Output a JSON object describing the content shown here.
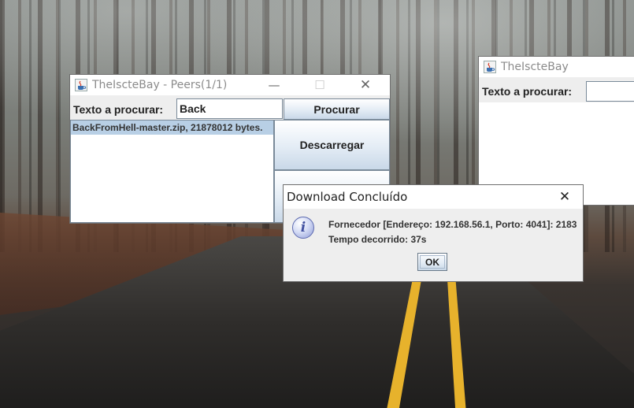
{
  "main_window": {
    "title": "TheIscteBay - Peers(1/1)",
    "search_label": "Texto a procurar:",
    "search_value": "Back",
    "search_button": "Procurar",
    "results": [
      "BackFromHell-master.zip, 21878012 bytes."
    ],
    "download_button": "Descarregar",
    "controls": {
      "minimize": "—",
      "maximize": "☐",
      "close": "✕"
    }
  },
  "second_window": {
    "title": "TheIscteBay",
    "search_label": "Texto a procurar:",
    "search_value": ""
  },
  "dialog": {
    "title": "Download Concluído",
    "close": "✕",
    "message_line1": "Fornecedor [Endereço: 192.168.56.1, Porto: 4041]: 2183",
    "message_line2": "Tempo decorrido: 37s",
    "ok_button": "OK",
    "icon": "info-icon"
  },
  "colors": {
    "list_selection": "#b8cfe5",
    "button_gradient_bottom": "#c9d8e8",
    "road_line": "#e7b22c"
  }
}
